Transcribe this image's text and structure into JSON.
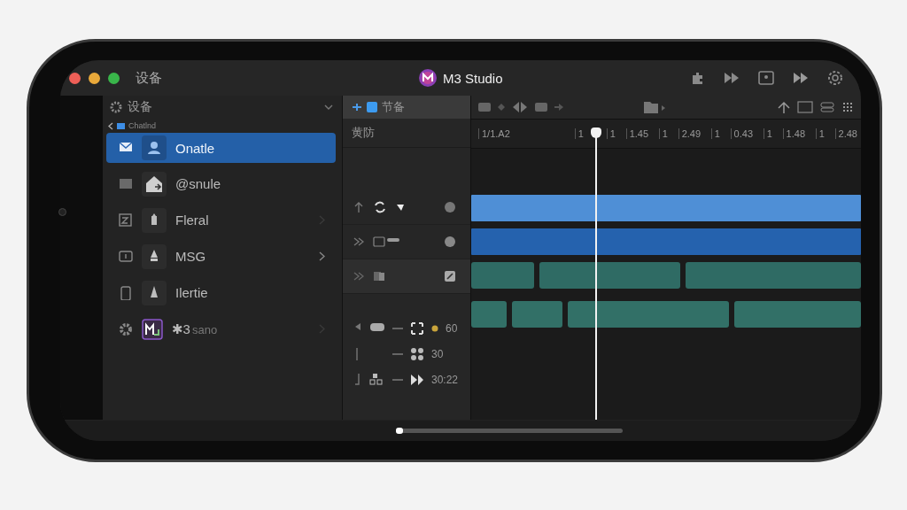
{
  "window": {
    "location": "设备",
    "title": "M3 Studio"
  },
  "sidebar": {
    "header": "设备",
    "breadcrumb": "Chatlnd",
    "items": [
      {
        "label": "Onatle",
        "selected": true,
        "chevron": false
      },
      {
        "label": "@snule",
        "selected": false,
        "chevron": false
      },
      {
        "label": "Fleral",
        "selected": false,
        "chevron": true
      },
      {
        "label": "MSG",
        "selected": false,
        "chevron": true
      },
      {
        "label": "Ilertie",
        "selected": false,
        "chevron": false
      },
      {
        "label": "✱3",
        "sublabel": "sano",
        "selected": false,
        "chevron": true
      }
    ]
  },
  "track_panel": {
    "tab": {
      "label": "节备",
      "selected": true
    },
    "label": "黄防",
    "headers": [
      {
        "kind": "top"
      },
      {
        "kind": "mid"
      },
      {
        "kind": "low"
      }
    ],
    "readouts": [
      "60",
      "30",
      "30:22"
    ]
  },
  "timeline": {
    "ruler": [
      "1/1.A2",
      "1",
      "1",
      "1.45",
      "1",
      "2.49",
      "1",
      "0.43",
      "1",
      "1.48",
      "1",
      "2.48"
    ],
    "playhead": {
      "level": 0.32
    },
    "tracks": [
      {
        "kind": "bar",
        "color": "#4f8fd6"
      },
      {
        "kind": "bar",
        "color": "#2562ae"
      },
      {
        "kind": "wave",
        "color": "#2f6b64"
      },
      {
        "kind": "clips",
        "color": "#327067"
      }
    ]
  }
}
